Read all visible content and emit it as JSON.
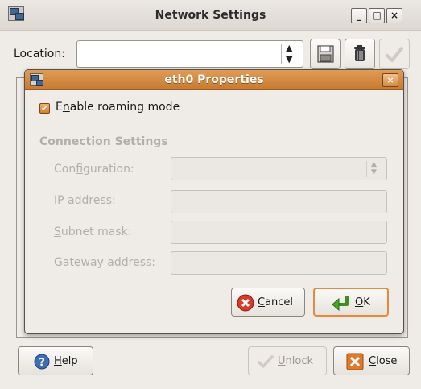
{
  "window": {
    "title": "Network Settings",
    "controls": {
      "minimize": "_",
      "maximize": "□",
      "close": "×"
    }
  },
  "location": {
    "label_prefix": "Location:",
    "value": "",
    "arrow": "▴▾"
  },
  "toolbar": {
    "save_icon": "floppy-disk-icon",
    "delete_icon": "trash-can-icon",
    "apply_icon": "checkmark-icon"
  },
  "dialog": {
    "title": "eth0 Properties",
    "close_glyph": "×",
    "roaming": {
      "checked": true,
      "label_pre": "E",
      "label_mnemonic": "n",
      "label_post": "able roaming mode"
    },
    "section_title": "Connection Settings",
    "fields": {
      "configuration": {
        "pre": "Con",
        "mnemonic": "f",
        "post": "iguration:",
        "value": ""
      },
      "ip": {
        "pre": "",
        "mnemonic": "I",
        "post": "P address:",
        "value": ""
      },
      "subnet": {
        "pre": "",
        "mnemonic": "S",
        "post": "ubnet mask:",
        "value": ""
      },
      "gateway": {
        "pre": "",
        "mnemonic": "G",
        "post": "ateway address:",
        "value": ""
      }
    },
    "cancel": {
      "mnemonic": "C",
      "rest": "ancel"
    },
    "ok": {
      "mnemonic": "O",
      "rest": "K"
    }
  },
  "bottom": {
    "help": {
      "mnemonic": "H",
      "rest": "elp"
    },
    "unlock": {
      "mnemonic": "U",
      "rest": "nlock",
      "enabled": false
    },
    "close": {
      "mnemonic": "C",
      "rest": "lose"
    }
  },
  "colors": {
    "accent": "#d88b3d",
    "disabled_text": "#b3afa8",
    "window_bg": "#efebe7"
  }
}
